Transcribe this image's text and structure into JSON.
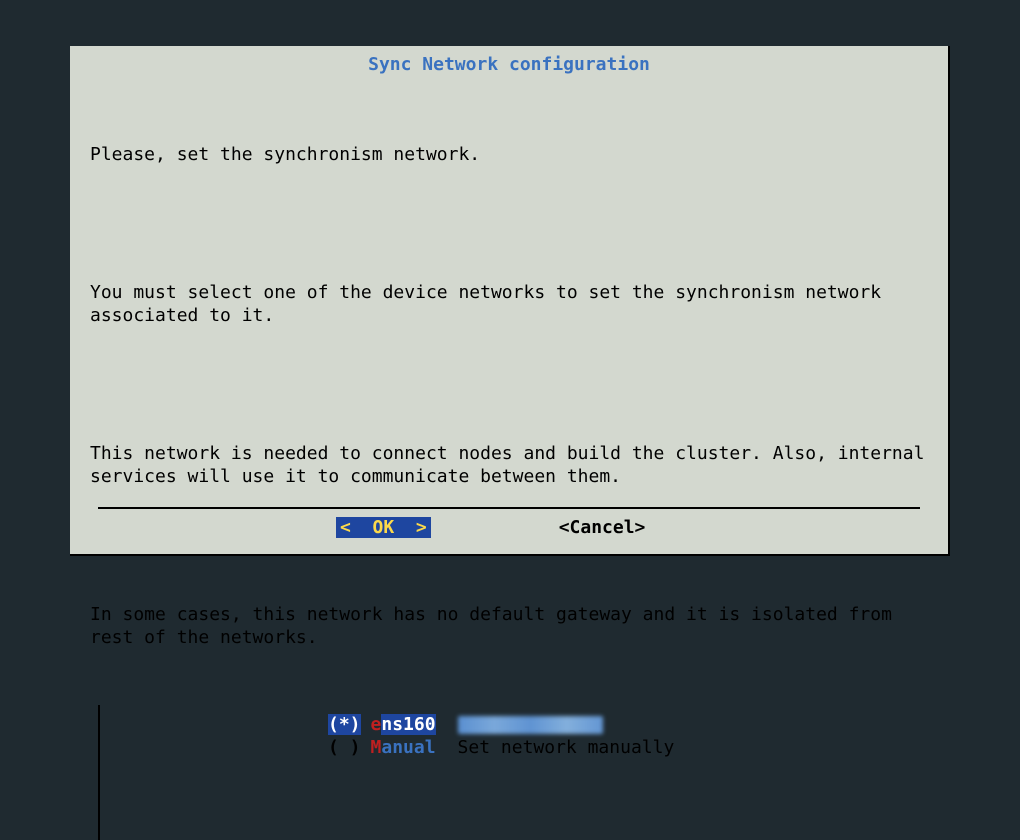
{
  "title": "Sync Network configuration",
  "body": {
    "line1": "Please, set the synchronism network.",
    "line2": "You must select one of the device networks to set the synchronism network associated to it.",
    "line3": "This network is needed to connect nodes and build the cluster. Also, internal services will use it to communicate between them.",
    "line4": "In some cases, this network has no default gateway and it is isolated from rest of the networks."
  },
  "options": [
    {
      "selected": true,
      "mark": "(*)",
      "hotkey": "e",
      "label_rest": "ns160",
      "desc": ""
    },
    {
      "selected": false,
      "mark": "( )",
      "hotkey": "M",
      "label_rest": "anual",
      "desc": "Set network manually"
    }
  ],
  "buttons": {
    "ok": "<  OK  >",
    "cancel": "<Cancel>"
  },
  "colors": {
    "background": "#1f2a30",
    "dialog_bg": "#d3d8cf",
    "accent_blue": "#1e46a0",
    "title_blue": "#3a72c0",
    "hotkey_red": "#c02020",
    "ok_yellow": "#fcd94b"
  }
}
